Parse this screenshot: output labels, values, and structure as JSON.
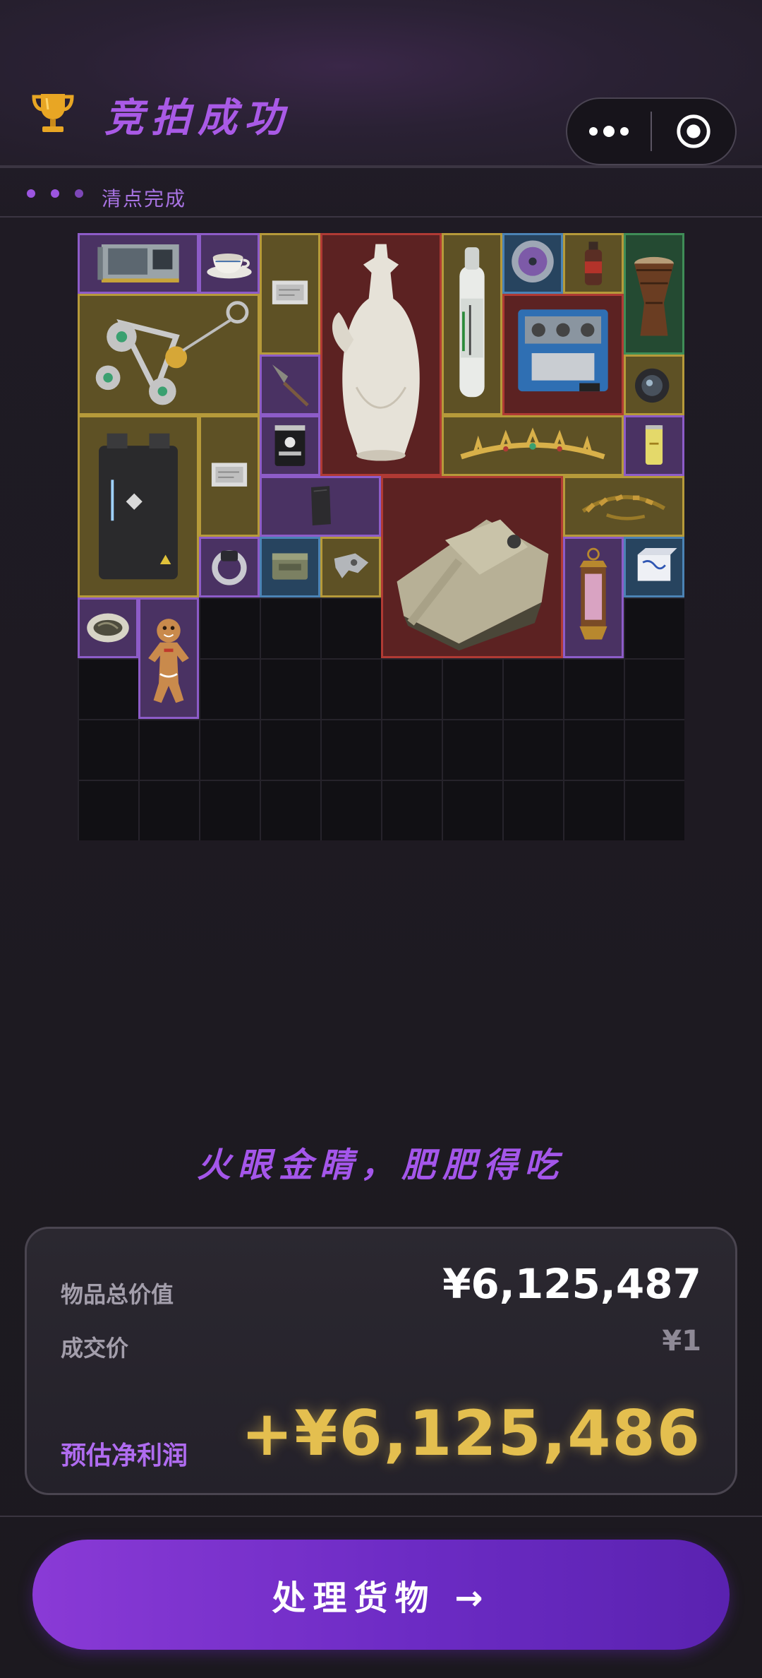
{
  "header": {
    "title": "竞拍成功",
    "status_text": "清点完成",
    "trophy_icon": "trophy-icon",
    "more_icon": "more-dots-icon",
    "close_icon": "target-close-icon"
  },
  "grid": {
    "columns": 10,
    "rows": 10,
    "items": [
      {
        "name": "graphics-card",
        "rarity": "purple"
      },
      {
        "name": "teacup",
        "rarity": "purple"
      },
      {
        "name": "silver-document",
        "rarity": "gold"
      },
      {
        "name": "porcelain-ewer",
        "rarity": "red"
      },
      {
        "name": "oxygen-tank",
        "rarity": "gold"
      },
      {
        "name": "disc",
        "rarity": "blue"
      },
      {
        "name": "drink-bottle",
        "rarity": "gold"
      },
      {
        "name": "djembe-drum",
        "rarity": "green"
      },
      {
        "name": "jeweled-necklace",
        "rarity": "gold"
      },
      {
        "name": "server-engine",
        "rarity": "red"
      },
      {
        "name": "arrowhead",
        "rarity": "purple"
      },
      {
        "name": "camera-lens",
        "rarity": "gold"
      },
      {
        "name": "power-supply-case",
        "rarity": "gold"
      },
      {
        "name": "silver-document-2",
        "rarity": "gold"
      },
      {
        "name": "protein-can",
        "rarity": "purple"
      },
      {
        "name": "golden-tiara",
        "rarity": "gold"
      },
      {
        "name": "energy-can",
        "rarity": "purple"
      },
      {
        "name": "stone-slab",
        "rarity": "purple"
      },
      {
        "name": "battle-tank",
        "rarity": "red"
      },
      {
        "name": "laurel-crown",
        "rarity": "gold"
      },
      {
        "name": "silver-ring",
        "rarity": "purple"
      },
      {
        "name": "ammo-tin",
        "rarity": "blue"
      },
      {
        "name": "metal-bracket",
        "rarity": "gold"
      },
      {
        "name": "ornate-lantern",
        "rarity": "purple"
      },
      {
        "name": "porcelain-box",
        "rarity": "blue"
      },
      {
        "name": "reptile-egg",
        "rarity": "purple"
      },
      {
        "name": "gingerbread-man",
        "rarity": "purple"
      }
    ]
  },
  "slogan": "火眼金睛，肥肥得吃",
  "summary": {
    "total_label": "物品总价值",
    "total_value": "¥6,125,487",
    "deal_label": "成交价",
    "deal_value": "¥1",
    "profit_label": "预估净利润",
    "profit_value": "+¥6,125,486"
  },
  "cta": {
    "label": "处理货物 →"
  },
  "colors": {
    "accent": "#a456ea",
    "gold": "#e4bf4f",
    "button": "#7a30cc"
  }
}
